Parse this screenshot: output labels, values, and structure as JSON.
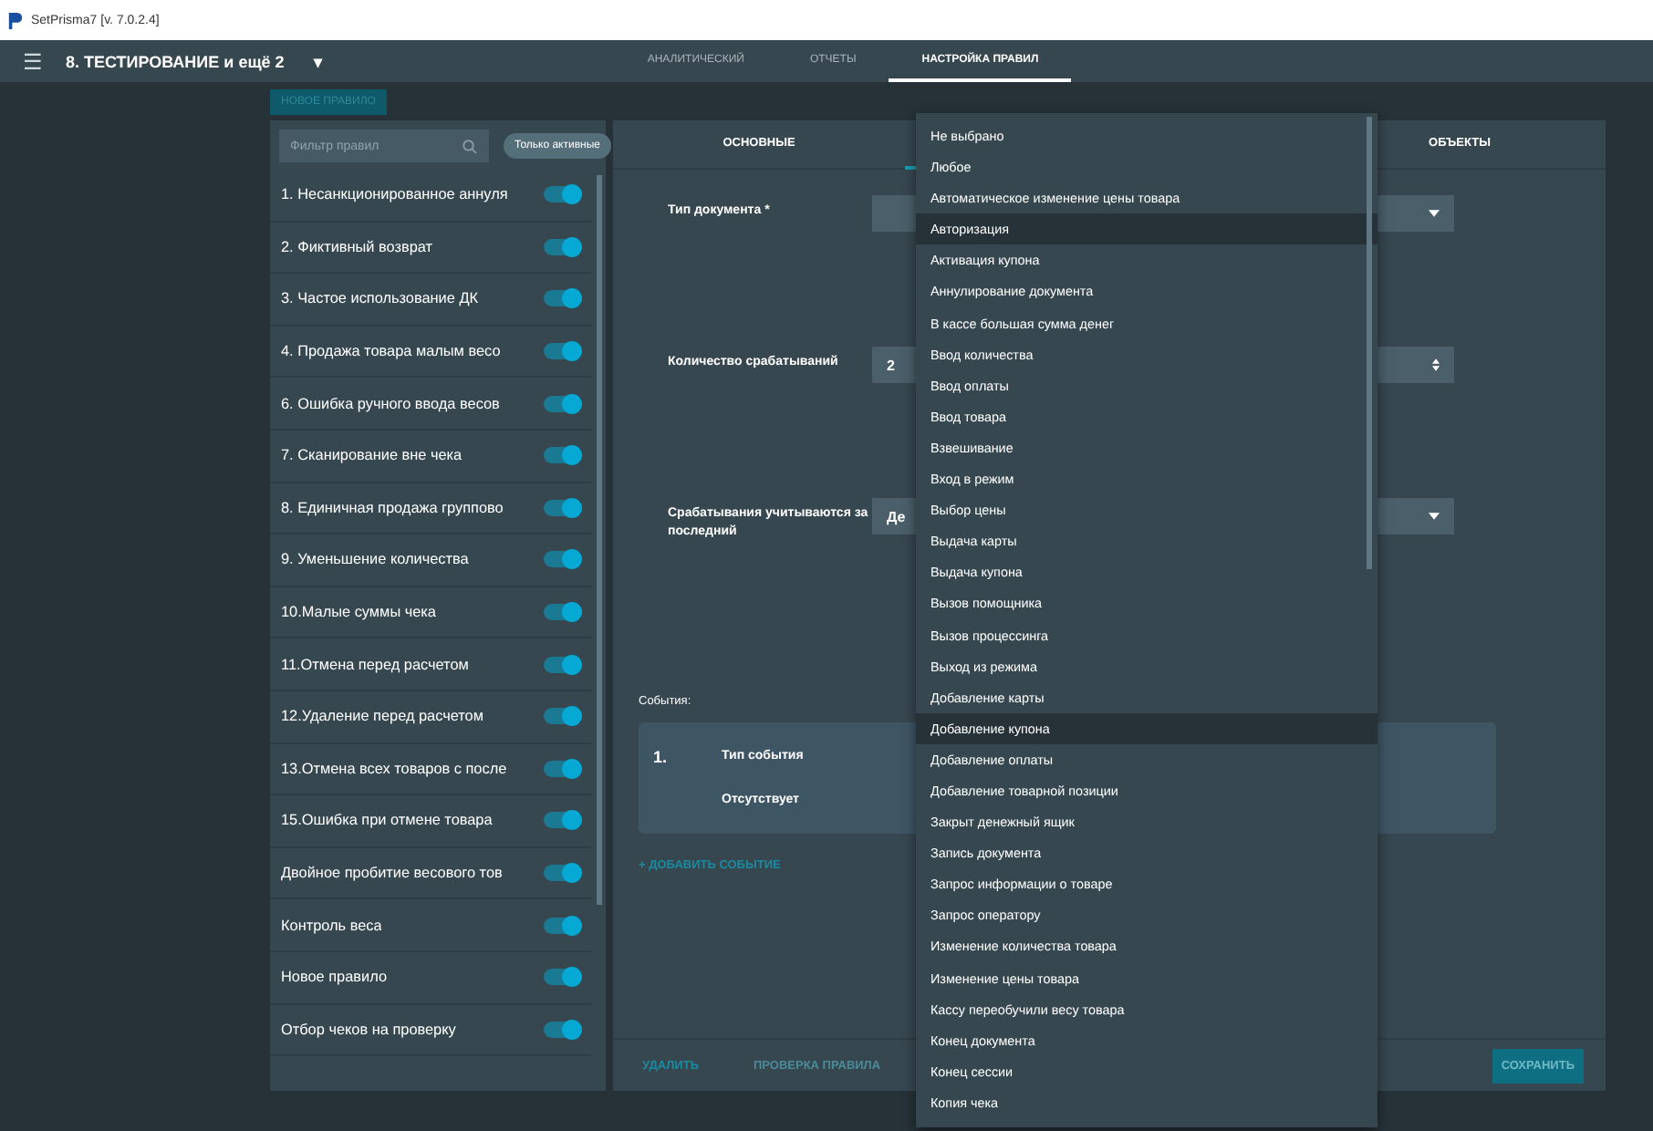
{
  "window": {
    "title": "SetPrisma7  [v. 7.0.2.4]"
  },
  "app_bar": {
    "menu": "☰",
    "project": "8. ТЕСТИРОВАНИЕ и ещё 2",
    "project_caret": "▾",
    "tabs": [
      {
        "label": "АНАЛИТИЧЕСКИЙ",
        "selected": false
      },
      {
        "label": "ОТЧЕТЫ",
        "selected": false
      },
      {
        "label": "НАСТРОЙКА ПРАВИЛ",
        "selected": true
      }
    ]
  },
  "new_rule_button": "НОВОЕ ПРАВИЛО",
  "rules_panel": {
    "filter_placeholder": "Фильтр правил",
    "only_active": "Только активные",
    "rules": [
      {
        "name": "1. Несанкционированное аннуля",
        "on": true
      },
      {
        "name": "2. Фиктивный возврат",
        "on": true
      },
      {
        "name": "3. Частое использование ДК",
        "on": true
      },
      {
        "name": "4. Продажа товара малым весо",
        "on": true
      },
      {
        "name": "6. Ошибка ручного ввода весов",
        "on": true
      },
      {
        "name": "7. Сканирование вне чека",
        "on": true
      },
      {
        "name": "8. Единичная продажа группово",
        "on": true
      },
      {
        "name": "9. Уменьшение количества",
        "on": true
      },
      {
        "name": "10.Малые суммы чека",
        "on": true
      },
      {
        "name": "11.Отмена перед расчетом",
        "on": true
      },
      {
        "name": "12.Удаление перед расчетом",
        "on": true
      },
      {
        "name": "13.Отмена всех товаров с после",
        "on": true
      },
      {
        "name": "15.Ошибка при отмене товара",
        "on": true
      },
      {
        "name": "Двойное пробитие весового тов",
        "on": true
      },
      {
        "name": "Контроль веса",
        "on": true
      },
      {
        "name": "Новое правило",
        "on": true
      },
      {
        "name": "Отбор чеков на проверку",
        "on": true
      }
    ]
  },
  "editor": {
    "tabs": [
      {
        "label": "ОСНОВНЫЕ",
        "selected": false
      },
      {
        "label": "ОБЪЕКТЫ",
        "selected": false
      }
    ],
    "fields": [
      {
        "kind": "select",
        "label": "Тип документа *"
      },
      {
        "kind": "number",
        "label": "Количество срабатываний",
        "value": "2"
      },
      {
        "kind": "select",
        "label": "Срабатывания учитываются за последний",
        "value": "Де"
      }
    ],
    "events_label": "События:",
    "events": [
      {
        "number": "1.",
        "type_label": "Тип события",
        "type_value": "Отсутствует"
      }
    ],
    "add_event": "+ ДОБАВИТЬ СОБЫТИЕ",
    "footer": {
      "delete": "УДАЛИТЬ",
      "check": "ПРОВЕРКА ПРАВИЛА",
      "save": "СОХРАНИТЬ"
    }
  },
  "dropdown": {
    "options": [
      {
        "label": "Не выбрано",
        "highlighted": false
      },
      {
        "label": "Любое",
        "highlighted": false
      },
      {
        "label": "Автоматическое изменение цены товара",
        "highlighted": false
      },
      {
        "label": "Авторизация",
        "highlighted": true
      },
      {
        "label": "Активация купона",
        "highlighted": false
      },
      {
        "label": "Аннулирование документа",
        "highlighted": false
      },
      {
        "label": "В кассе большая сумма денег",
        "highlighted": false
      },
      {
        "label": "Ввод количества",
        "highlighted": false
      },
      {
        "label": "Ввод оплаты",
        "highlighted": false
      },
      {
        "label": "Ввод товара",
        "highlighted": false
      },
      {
        "label": "Взвешивание",
        "highlighted": false
      },
      {
        "label": "Вход в режим",
        "highlighted": false
      },
      {
        "label": "Выбор цены",
        "highlighted": false
      },
      {
        "label": "Выдача карты",
        "highlighted": false
      },
      {
        "label": "Выдача купона",
        "highlighted": false
      },
      {
        "label": "Вызов помощника",
        "highlighted": false
      },
      {
        "label": "Вызов процессинга",
        "highlighted": false
      },
      {
        "label": "Выход из режима",
        "highlighted": false
      },
      {
        "label": "Добавление карты",
        "highlighted": false
      },
      {
        "label": "Добавление купона",
        "highlighted": true
      },
      {
        "label": "Добавление оплаты",
        "highlighted": false
      },
      {
        "label": "Добавление товарной позиции",
        "highlighted": false
      },
      {
        "label": "Закрыт денежный ящик",
        "highlighted": false
      },
      {
        "label": "Запись документа",
        "highlighted": false
      },
      {
        "label": "Запрос информации о товаре",
        "highlighted": false
      },
      {
        "label": "Запрос оператору",
        "highlighted": false
      },
      {
        "label": "Изменение количества товара",
        "highlighted": false
      },
      {
        "label": "Изменение цены товара",
        "highlighted": false
      },
      {
        "label": "Кассу переобучили весу товара",
        "highlighted": false
      },
      {
        "label": "Конец документа",
        "highlighted": false
      },
      {
        "label": "Конец сессии",
        "highlighted": false
      },
      {
        "label": "Копия чека",
        "highlighted": false
      }
    ]
  }
}
